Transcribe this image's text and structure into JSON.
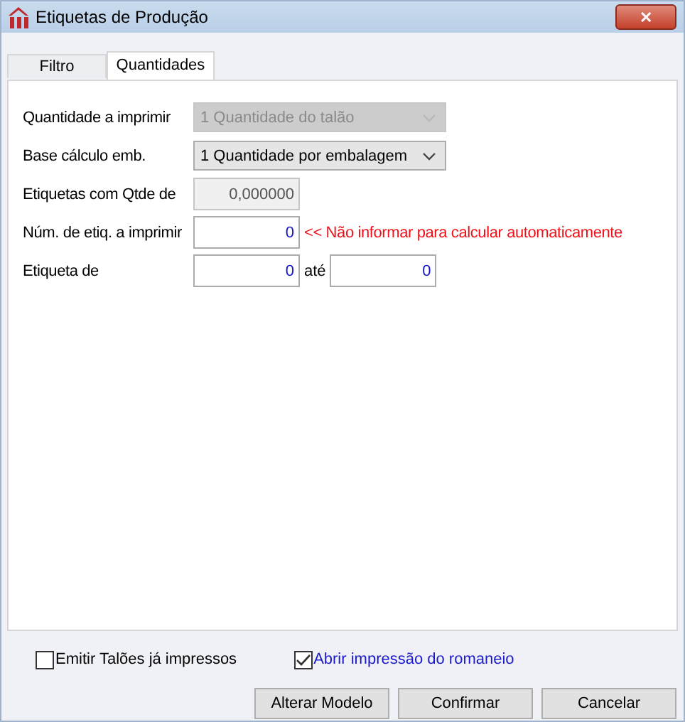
{
  "window": {
    "title": "Etiquetas de Produção",
    "close": "✕"
  },
  "tabs": [
    {
      "label": "Filtro",
      "selected": false
    },
    {
      "label": "Quantidades",
      "selected": true
    }
  ],
  "form": [
    {
      "kind": "select",
      "label": "Quantidade a imprimir",
      "value": "1 Quantidade do talão",
      "disabled": true
    },
    {
      "kind": "select",
      "label": "Base cálculo emb.",
      "value": "1 Quantidade por embalagem",
      "disabled": false
    },
    {
      "kind": "number",
      "label": "Etiquetas com Qtde de",
      "value": "0,000000",
      "disabled": true
    },
    {
      "kind": "number",
      "label": "Núm. de etiq. a imprimir",
      "value": "0",
      "disabled": false,
      "hint": "<< Não informar para calcular automaticamente"
    },
    {
      "kind": "range",
      "label": "Etiqueta de",
      "value": "0",
      "separator": "até",
      "value_to": "0",
      "disabled": false
    }
  ],
  "checkboxes": [
    {
      "label": "Emitir Talões já impressos",
      "checked": false
    },
    {
      "label": "Abrir impressão do romaneio",
      "checked": true
    }
  ],
  "buttons": [
    "Alterar Modelo",
    "Confirmar",
    "Cancelar"
  ]
}
